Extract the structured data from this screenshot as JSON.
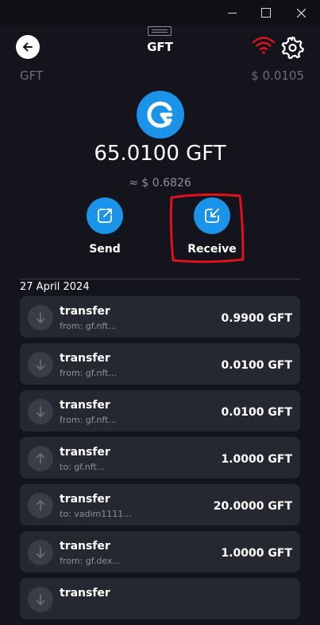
{
  "header": {
    "title": "GFT"
  },
  "token": {
    "symbol": "GFT",
    "price": "$ 0.0105",
    "balance": "65.0100 GFT",
    "balance_usd": "≈ $ 0.6826"
  },
  "actions": {
    "send_label": "Send",
    "receive_label": "Receive"
  },
  "history": {
    "date": "27 April 2024",
    "transactions": [
      {
        "type": "transfer",
        "party": "from: gf.nft...",
        "amount": "0.9900 GFT",
        "direction": "in"
      },
      {
        "type": "transfer",
        "party": "from: gf.nft...",
        "amount": "0.0100 GFT",
        "direction": "in"
      },
      {
        "type": "transfer",
        "party": "from: gf.nft...",
        "amount": "0.0100 GFT",
        "direction": "in"
      },
      {
        "type": "transfer",
        "party": "to: gf.nft...",
        "amount": "1.0000 GFT",
        "direction": "out"
      },
      {
        "type": "transfer",
        "party": "to: vadim1111...",
        "amount": "20.0000 GFT",
        "direction": "out"
      },
      {
        "type": "transfer",
        "party": "from: gf.dex...",
        "amount": "1.0000 GFT",
        "direction": "in"
      },
      {
        "type": "transfer",
        "party": "",
        "amount": "",
        "direction": "in"
      }
    ]
  },
  "colors": {
    "background": "#14151c",
    "accent": "#1a93e8",
    "card": "#262831",
    "annotation": "#e0121b",
    "wifi": "#e0121b"
  },
  "icons": {
    "back": "arrow-left-icon",
    "network": "wifi-icon",
    "settings": "gear-icon",
    "send": "arrow-up-right-icon",
    "receive": "arrow-down-left-icon",
    "incoming": "arrow-down-icon",
    "outgoing": "arrow-up-icon"
  }
}
